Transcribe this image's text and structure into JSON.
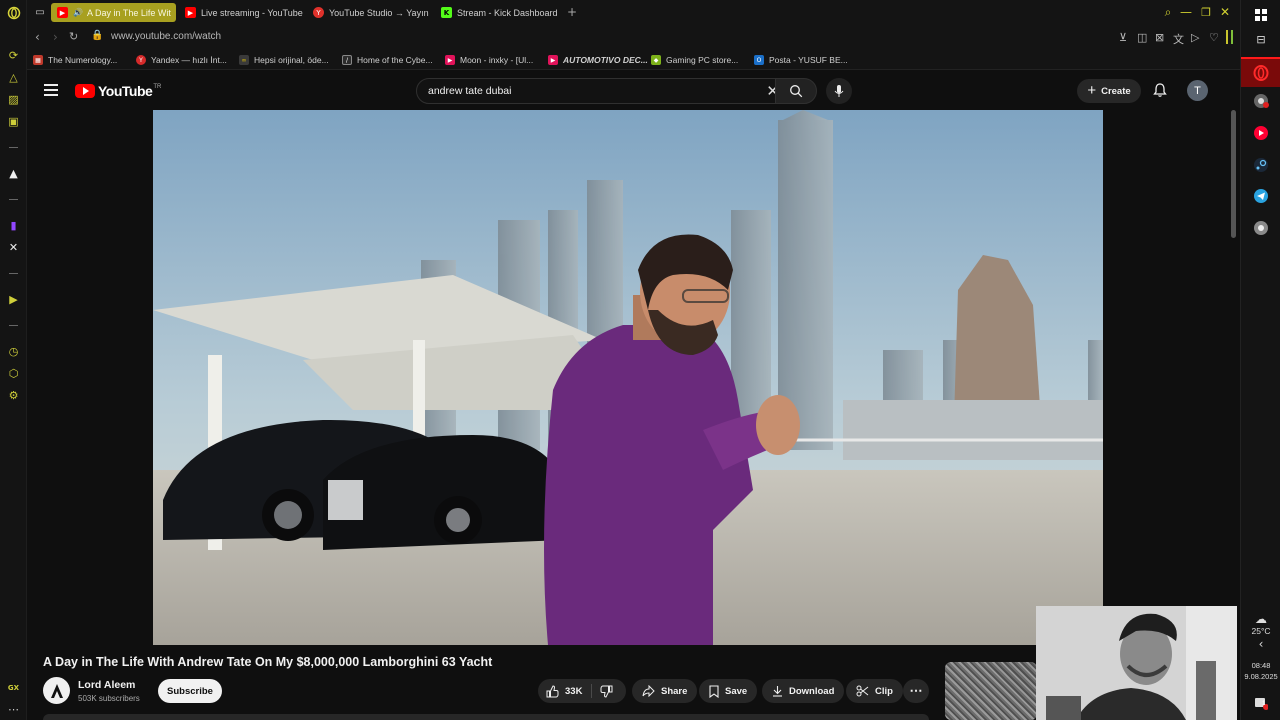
{
  "browser": {
    "tabs": [
      {
        "label": "A Day in The Life Wit",
        "favicon": "youtube-icon",
        "active": true
      },
      {
        "label": "Live streaming - YouTube",
        "favicon": "youtube-icon",
        "active": false
      },
      {
        "label": "YouTube Studio → Yayın",
        "favicon": "yandex-icon",
        "active": false
      },
      {
        "label": "Stream - Kick Dashboard",
        "favicon": "kick-icon",
        "active": false
      }
    ],
    "url": "www.youtube.com/watch",
    "bookmarks": [
      {
        "label": "The Numerology...",
        "color": "#c0392b"
      },
      {
        "label": "Yandex — hızlı İnt...",
        "color": "#d62a2a"
      },
      {
        "label": "Hepsi orijinal, öde...",
        "color": "#3a3a3a"
      },
      {
        "label": "Home of the Cybe...",
        "color": "#2c2c2c"
      },
      {
        "label": "Moon - inxky - [Ul...",
        "color": "#e1135a"
      },
      {
        "label": "AUTOMOTIVO DEC...",
        "color": "#e1135a"
      },
      {
        "label": "Gaming PC store...",
        "color": "#7db21a"
      },
      {
        "label": "Posta - YUSUF BE...",
        "color": "#1a6fc9"
      }
    ]
  },
  "youtube": {
    "logo_text": "YouTube",
    "logo_suffix": "TR",
    "search_query": "andrew tate dubai",
    "create_label": "Create",
    "avatar_letter": "T",
    "video_title": "A Day in The Life With Andrew Tate On My $8,000,000 Lamborghini 63 Yacht",
    "channel_name": "Lord Aleem",
    "channel_subs": "503K subscribers",
    "subscribe_label": "Subscribe",
    "like_count": "33K",
    "share_label": "Share",
    "save_label": "Save",
    "download_label": "Download",
    "clip_label": "Clip"
  },
  "system": {
    "temperature": "25°C",
    "time": "08:48",
    "date": "9.08.2025",
    "notification_count": "1"
  },
  "colors": {
    "accent_gx": "#a8a020",
    "youtube_red": "#ff0000",
    "background": "#0f0f0f"
  }
}
